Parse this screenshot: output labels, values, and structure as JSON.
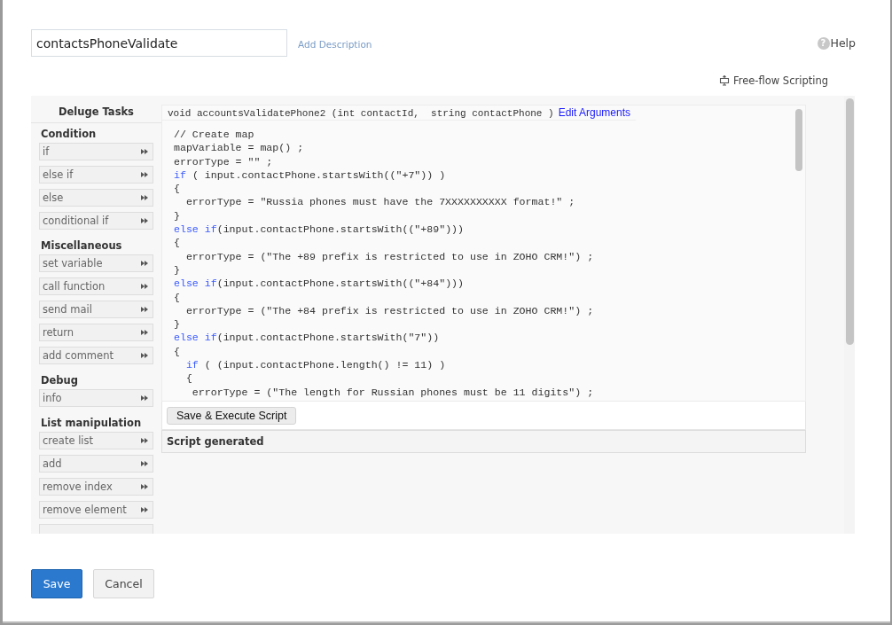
{
  "function_name": {
    "value": "contactsPhoneValidate"
  },
  "add_description": "Add Description",
  "help": {
    "label": "Help",
    "icon_text": "?"
  },
  "free_flow": "Free-flow Scripting",
  "sidebar": {
    "title": "Deluge Tasks",
    "groups": [
      {
        "title": "Condition",
        "items": [
          "if",
          "else if",
          "else",
          "conditional if"
        ]
      },
      {
        "title": "Miscellaneous",
        "items": [
          "set variable",
          "call function",
          "send mail",
          "return",
          "add comment"
        ]
      },
      {
        "title": "Debug",
        "items": [
          "info"
        ]
      },
      {
        "title": "List manipulation",
        "items": [
          "create list",
          "add",
          "remove index",
          "remove element"
        ],
        "cut_item": true
      }
    ]
  },
  "signature": {
    "text": "void accountsValidatePhone2 (int contactId,  string contactPhone )",
    "link": "Edit Arguments"
  },
  "code": [
    {
      "text": "// Create map"
    },
    {
      "text": "mapVariable = map() ;"
    },
    {
      "text": "errorType = \"\" ;"
    },
    {
      "keyword": "if",
      "text": " ( input.contactPhone.startsWith((\"+7\")) )"
    },
    {
      "text": "{"
    },
    {
      "text": "  errorType = \"Russia phones must have the 7XXXXXXXXXX format!\" ;"
    },
    {
      "text": "}"
    },
    {
      "keyword": "else if",
      "text": "(input.contactPhone.startsWith((\"+89\")))"
    },
    {
      "text": "{"
    },
    {
      "text": "  errorType = (\"The +89 prefix is restricted to use in ZOHO CRM!\") ;"
    },
    {
      "text": "}"
    },
    {
      "keyword": "else if",
      "text": "(input.contactPhone.startsWith((\"+84\")))"
    },
    {
      "text": "{"
    },
    {
      "text": "  errorType = (\"The +84 prefix is restricted to use in ZOHO CRM!\") ;"
    },
    {
      "text": "}"
    },
    {
      "keyword": "else if",
      "text": "(input.contactPhone.startsWith(\"7\"))"
    },
    {
      "text": "{"
    },
    {
      "keyword": "  if",
      "text": " ( (input.contactPhone.length() != 11) )"
    },
    {
      "text": "  {"
    },
    {
      "text": "   errorType = (\"The length for Russian phones must be 11 digits\") ;"
    }
  ],
  "execute_button": "Save & Execute Script",
  "result_title": "Script generated",
  "buttons": [
    {
      "label": "Save",
      "kind": "primary"
    },
    {
      "label": "Cancel",
      "kind": "secondary"
    }
  ]
}
